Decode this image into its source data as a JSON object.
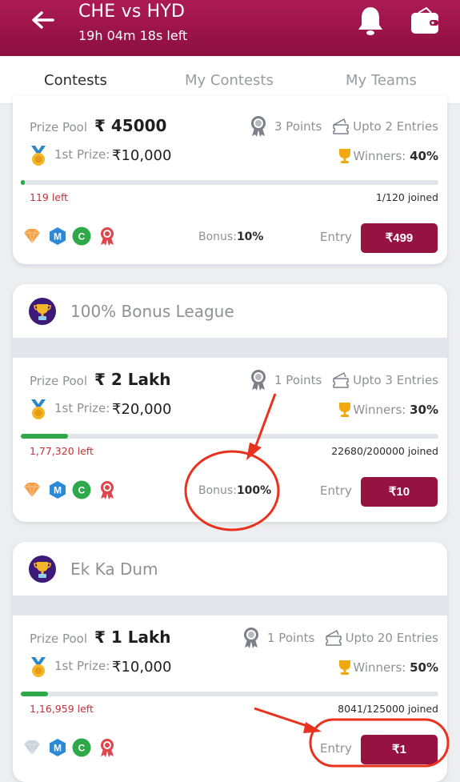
{
  "header": {
    "title": "CHE vs HYD",
    "countdown": "19h 04m 18s left",
    "icons": [
      "back-arrow-icon",
      "bell-icon",
      "wallet-icon"
    ]
  },
  "tabs": [
    {
      "label": "Contests",
      "active": true
    },
    {
      "label": "My Contests",
      "active": false
    },
    {
      "label": "My Teams",
      "active": false
    }
  ],
  "contests": [
    {
      "league_name": "",
      "prize_pool_label": "Prize Pool",
      "prize_pool": "₹ 45000",
      "points": "3 Points",
      "entries": "Upto 2 Entries",
      "first_prize_label": "1st Prize:",
      "first_prize": "₹10,000",
      "winners_label": "Winners:",
      "winners": "40%",
      "progress_fraction": 0.0083,
      "spots_left": "119 left",
      "joined": "1/120 joined",
      "bonus_label": "Bonus:",
      "bonus": "10%",
      "entry_label": "Entry",
      "entry_fee": "₹499",
      "diamond_color": "#f4a24a"
    },
    {
      "league_name": "100% Bonus League",
      "prize_pool_label": "Prize Pool",
      "prize_pool": "₹ 2 Lakh",
      "points": "1 Points",
      "entries": "Upto 3 Entries",
      "first_prize_label": "1st Prize:",
      "first_prize": "₹20,000",
      "winners_label": "Winners:",
      "winners": "30%",
      "progress_fraction": 0.1134,
      "spots_left": "1,77,320 left",
      "joined": "22680/200000 joined",
      "bonus_label": "Bonus:",
      "bonus": "100%",
      "entry_label": "Entry",
      "entry_fee": "₹10",
      "diamond_color": "#f4a24a"
    },
    {
      "league_name": "Ek Ka Dum",
      "prize_pool_label": "Prize Pool",
      "prize_pool": "₹ 1 Lakh",
      "points": "1 Points",
      "entries": "Upto 20 Entries",
      "first_prize_label": "1st Prize:",
      "first_prize": "₹10,000",
      "winners_label": "Winners:",
      "winners": "50%",
      "progress_fraction": 0.0643,
      "spots_left": "1,16,959 left",
      "joined": "8041/125000 joined",
      "bonus_label": "",
      "bonus": "",
      "entry_label": "Entry",
      "entry_fee": "₹1",
      "diamond_color": "#c9d3dc"
    }
  ],
  "colors": {
    "brand": "#961240",
    "progress": "#2fa84a",
    "spots_left": "#c1323a",
    "annotation": "#e8321e"
  }
}
